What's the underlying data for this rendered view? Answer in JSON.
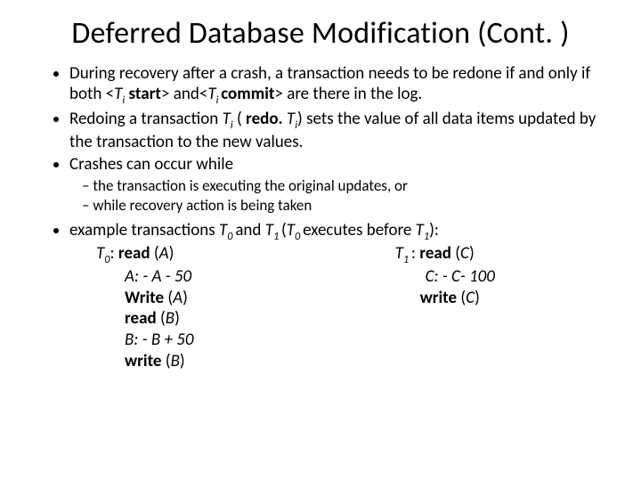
{
  "title": "Deferred Database Modification (Cont. )",
  "bullets": {
    "b1_pre": "During recovery after a crash, a transaction needs to be redone if and only if both <",
    "b1_ti1": "T",
    "b1_sub": "i",
    "b1_mid1": "  ",
    "b1_start": "start",
    "b1_mid2": "> and<",
    "b1_ti2": "T",
    "b1_sub2": "i ",
    "b1_commit": "commit",
    "b1_post": "> are there in the log.",
    "b2_pre": "Redoing a transaction ",
    "b2_ti": "T",
    "b2_sub": "i",
    "b2_mid1": " ( ",
    "b2_redo": "redo. ",
    "b2_ti2": "T",
    "b2_sub2": "i",
    "b2_post": ") sets the value of all data items updated by the transaction to the new values.",
    "b3": "Crashes can occur while",
    "sub1": "the transaction is executing the original updates, or",
    "sub2": "while recovery action is being taken",
    "b4_pre": "example transactions  ",
    "b4_t0": "T",
    "b4_s0": "0 ",
    "b4_and": "and ",
    "b4_t1": "T",
    "b4_s1": "1 ",
    "b4_paren_open": "(",
    "b4_t0b": "T",
    "b4_s0b": "0 ",
    "b4_mid": "executes before ",
    "b4_t1b": "T",
    "b4_s1b": "1",
    "b4_close": "):"
  },
  "left": {
    "l1_t": "T",
    "l1_s": "0",
    "l1_rest": ": ",
    "l1_read": "read",
    "l1_arg": " (",
    "l1_A": "A",
    "l1_cp": ")",
    "l2": "A: - A - 50",
    "l3_w": "Write",
    "l3_rest": " (",
    "l3_A": "A",
    "l3_cp": ")",
    "l4_r": "read",
    "l4_rest": " (",
    "l4_B": "B",
    "l4_cp": ")",
    "l5": "B: -  B + 50",
    "l6_w": "write",
    "l6_rest": " (",
    "l6_B": "B",
    "l6_cp": ")"
  },
  "right": {
    "r1_t": "T",
    "r1_s": "1 ",
    "r1_colon": ": ",
    "r1_read": "read",
    "r1_rest": " (",
    "r1_C": "C",
    "r1_cp": ")",
    "r2": "C: -  C- 100",
    "r3_w": "write",
    "r3_rest": " (",
    "r3_C": "C",
    "r3_cp": ")"
  }
}
